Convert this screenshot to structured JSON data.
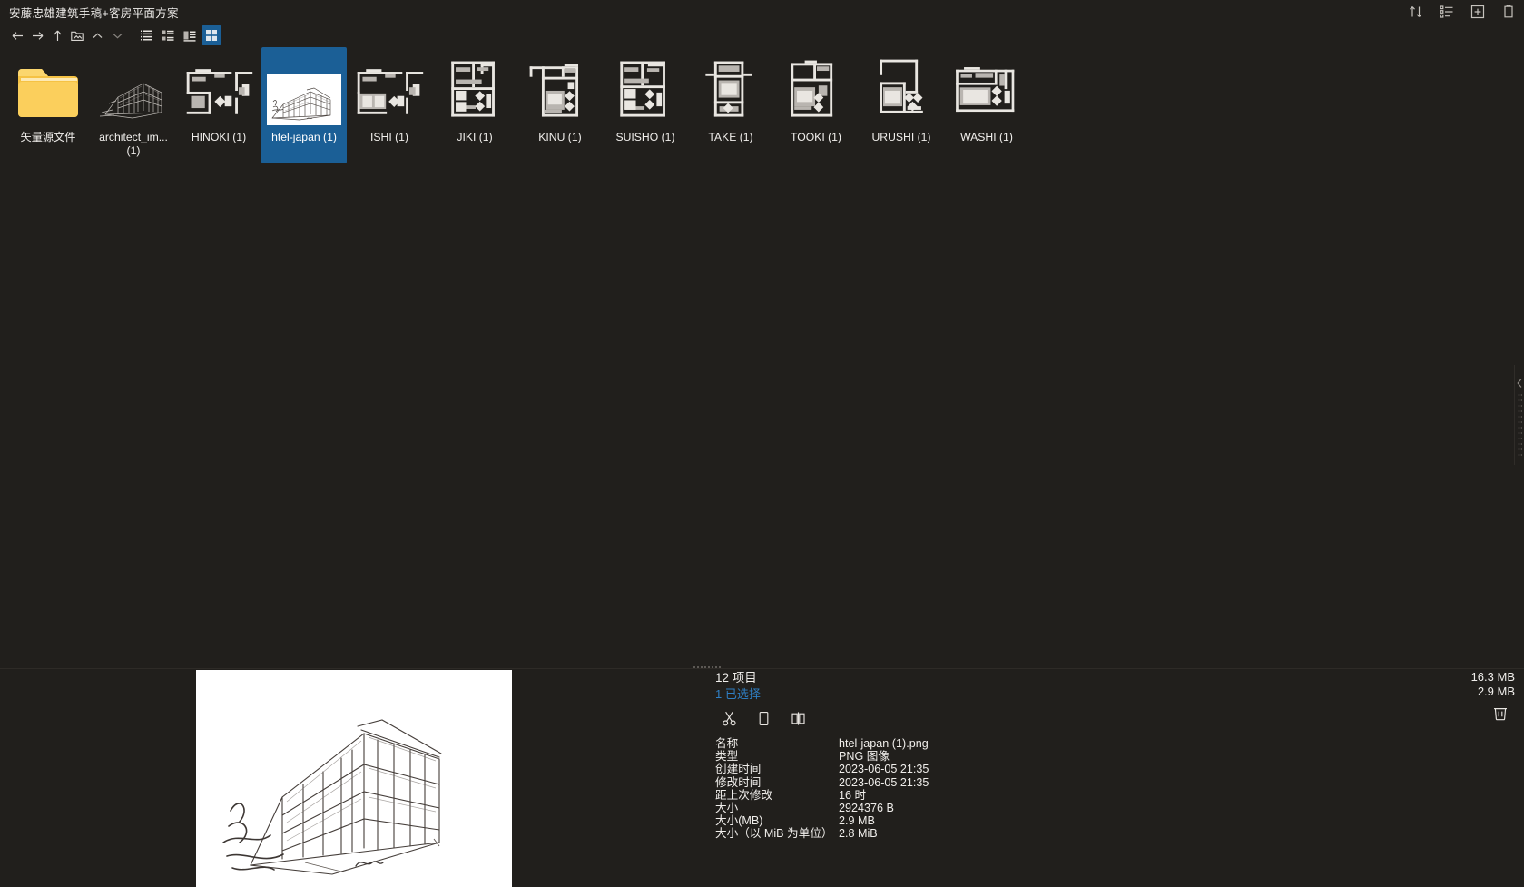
{
  "window": {
    "title": "安藤忠雄建筑手稿+客房平面方案"
  },
  "titlebar_actions": [
    {
      "name": "sort-icon",
      "label": "排序"
    },
    {
      "name": "view-options-icon",
      "label": "视图选项"
    },
    {
      "name": "new-tab-icon",
      "label": "新建标签页"
    },
    {
      "name": "clipboard-icon",
      "label": "剪贴板"
    }
  ],
  "toolbar": {
    "nav": [
      {
        "name": "back-button",
        "label": "后退"
      },
      {
        "name": "forward-button",
        "label": "前进"
      },
      {
        "name": "up-button",
        "label": "向上"
      },
      {
        "name": "open-folder-button",
        "label": "打开文件夹"
      },
      {
        "name": "collapse-button",
        "label": "折叠"
      },
      {
        "name": "expand-button",
        "label": "展开"
      }
    ],
    "views": [
      {
        "name": "view-list",
        "label": "列表视图",
        "active": false
      },
      {
        "name": "view-compact",
        "label": "紧凑视图",
        "active": false
      },
      {
        "name": "view-details",
        "label": "详细视图",
        "active": false
      },
      {
        "name": "view-icons",
        "label": "图标视图",
        "active": true
      }
    ]
  },
  "grid": {
    "items": [
      {
        "name": "矢量源文件",
        "kind": "folder",
        "selected": false
      },
      {
        "name": "architect_im...\n(1)",
        "label_line1": "architect_im...",
        "label_line2": "(1)",
        "kind": "sketch",
        "selected": false
      },
      {
        "name": "HINOKI (1)",
        "kind": "plan-a",
        "selected": false
      },
      {
        "name": "htel-japan (1)",
        "kind": "sketch-thumb",
        "selected": true
      },
      {
        "name": "ISHI (1)",
        "kind": "plan-a",
        "selected": false
      },
      {
        "name": "JIKI (1)",
        "kind": "plan-b",
        "selected": false
      },
      {
        "name": "KINU (1)",
        "kind": "plan-c",
        "selected": false
      },
      {
        "name": "SUISHO (1)",
        "kind": "plan-b",
        "selected": false
      },
      {
        "name": "TAKE (1)",
        "kind": "plan-d",
        "selected": false
      },
      {
        "name": "TOOKI (1)",
        "kind": "plan-c",
        "selected": false
      },
      {
        "name": "URUSHI (1)",
        "kind": "plan-e",
        "selected": false
      },
      {
        "name": "WASHI (1)",
        "kind": "plan-f",
        "selected": false
      }
    ]
  },
  "status": {
    "item_count": "12 项目",
    "selected_count": "1 已选择",
    "total_size": "16.3 MB",
    "selected_size": "2.9 MB"
  },
  "quick_actions": [
    {
      "name": "cut-icon",
      "label": "剪切"
    },
    {
      "name": "copy-icon",
      "label": "复制"
    },
    {
      "name": "compare-icon",
      "label": "对比"
    }
  ],
  "trash": {
    "name": "trash-icon",
    "label": "删除"
  },
  "details": {
    "rows": [
      {
        "key": "名称",
        "value": "htel-japan (1).png"
      },
      {
        "key": "类型",
        "value": "PNG 图像"
      },
      {
        "key": "创建时间",
        "value": "2023-06-05  21:35"
      },
      {
        "key": "修改时间",
        "value": "2023-06-05  21:35"
      },
      {
        "key": "距上次修改",
        "value": "16 时"
      },
      {
        "key": "大小",
        "value": "2924376 B"
      },
      {
        "key": "大小(MB)",
        "value": "2.9 MB"
      },
      {
        "key": "大小（以 MiB 为单位）",
        "value": "2.8 MiB"
      }
    ]
  },
  "colors": {
    "background": "#211f1c",
    "selection": "#1b5f96",
    "link": "#2f7fc4",
    "text": "#f0eeeb",
    "folder": "#f5c244"
  }
}
